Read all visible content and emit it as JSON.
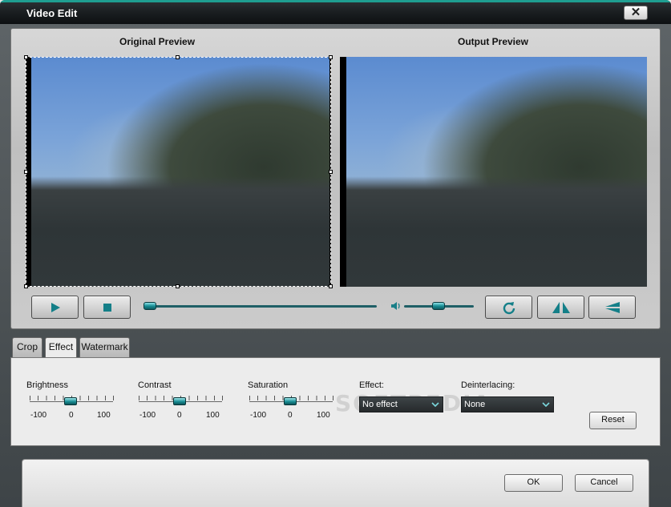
{
  "window": {
    "title": "Video Edit",
    "close_glyph": "✕"
  },
  "preview": {
    "original_title": "Original Preview",
    "output_title": "Output Preview",
    "seek_progress": 0.0,
    "volume_level": 0.5
  },
  "controls": {
    "play_icon": "play-icon",
    "stop_icon": "stop-icon",
    "volume_icon": "speaker-icon",
    "rotate_icon": "rotate-icon",
    "flip_horizontal_icon": "flip-horizontal-icon",
    "flip_vertical_icon": "flip-vertical-icon"
  },
  "tabs": [
    {
      "label": "Crop",
      "active": false
    },
    {
      "label": "Effect",
      "active": true
    },
    {
      "label": "Watermark",
      "active": false
    }
  ],
  "effect": {
    "brightness": {
      "label": "Brightness",
      "min": "-100",
      "mid": "0",
      "max": "100",
      "value": 0
    },
    "contrast": {
      "label": "Contrast",
      "min": "-100",
      "mid": "0",
      "max": "100",
      "value": 0
    },
    "saturation": {
      "label": "Saturation",
      "min": "-100",
      "mid": "0",
      "max": "100",
      "value": 0
    },
    "effect_label": "Effect:",
    "effect_value": "No effect",
    "deinterlacing_label": "Deinterlacing:",
    "deinterlacing_value": "None",
    "reset_label": "Reset"
  },
  "footer": {
    "ok_label": "OK",
    "cancel_label": "Cancel"
  },
  "watermark_text": "SOFTPEDIA",
  "colors": {
    "accent": "#1a8f96",
    "title_bar": "#1a1e21",
    "title_accent": "#1f9e91"
  }
}
